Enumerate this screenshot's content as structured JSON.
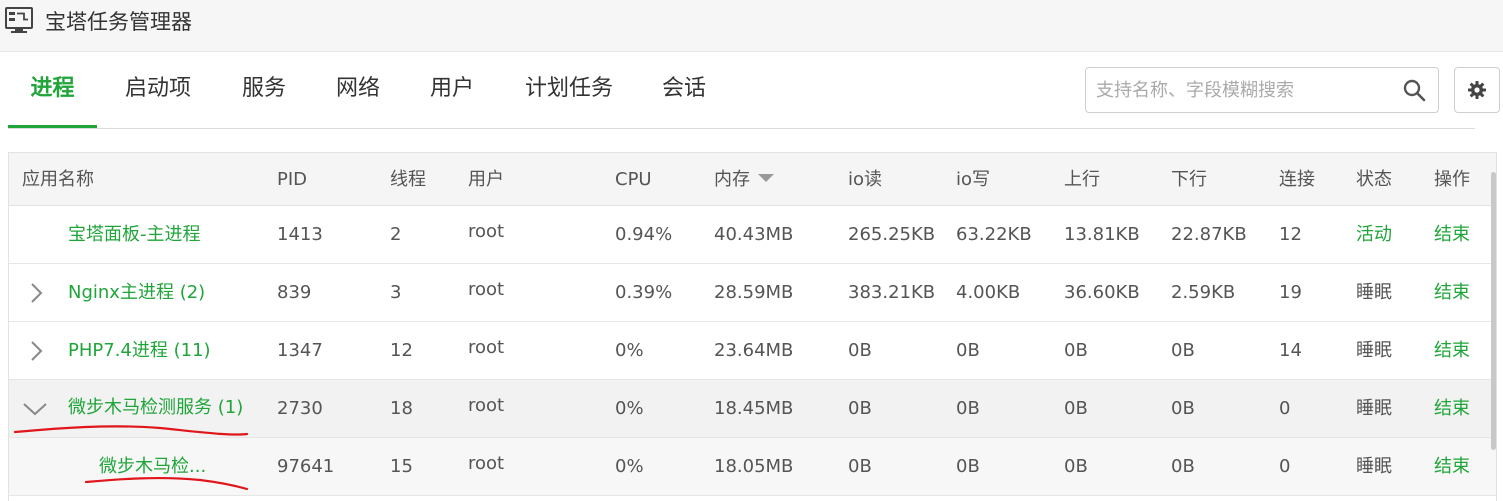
{
  "window": {
    "title": "宝塔任务管理器",
    "icon": "monitor-icon"
  },
  "tabs": [
    {
      "label": "进程",
      "active": true
    },
    {
      "label": "启动项"
    },
    {
      "label": "服务"
    },
    {
      "label": "网络"
    },
    {
      "label": "用户"
    },
    {
      "label": "计划任务"
    },
    {
      "label": "会话"
    }
  ],
  "search": {
    "placeholder": "支持名称、字段模糊搜索",
    "value": "",
    "icon": "search-icon"
  },
  "settings": {
    "icon": "gear-icon"
  },
  "columns": {
    "name": "应用名称",
    "pid": "PID",
    "threads": "线程",
    "user": "用户",
    "cpu": "CPU",
    "mem": "内存",
    "io_read": "io读",
    "io_write": "io写",
    "up": "上行",
    "down": "下行",
    "conn": "连接",
    "status": "状态",
    "action": "操作"
  },
  "sort": {
    "column": "内存",
    "direction": "desc"
  },
  "rows": [
    {
      "name": "宝塔面板-主进程",
      "count": "",
      "pid": "1413",
      "threads": "2",
      "user": "root",
      "cpu": "0.94%",
      "mem": "40.43MB",
      "io_read": "265.25KB",
      "io_write": "63.22KB",
      "up": "13.81KB",
      "down": "22.87KB",
      "conn": "12",
      "status": "活动",
      "action": "结束"
    },
    {
      "name": "Nginx主进程",
      "count": "(2)",
      "pid": "839",
      "threads": "3",
      "user": "root",
      "cpu": "0.39%",
      "mem": "28.59MB",
      "io_read": "383.21KB",
      "io_write": "4.00KB",
      "up": "36.60KB",
      "down": "2.59KB",
      "conn": "19",
      "status": "睡眠",
      "action": "结束"
    },
    {
      "name": "PHP7.4进程",
      "count": "(11)",
      "pid": "1347",
      "threads": "12",
      "user": "root",
      "cpu": "0%",
      "mem": "23.64MB",
      "io_read": "0B",
      "io_write": "0B",
      "up": "0B",
      "down": "0B",
      "conn": "14",
      "status": "睡眠",
      "action": "结束"
    },
    {
      "name": "微步木马检测服务",
      "count": "(1)",
      "pid": "2730",
      "threads": "18",
      "user": "root",
      "cpu": "0%",
      "mem": "18.45MB",
      "io_read": "0B",
      "io_write": "0B",
      "up": "0B",
      "down": "0B",
      "conn": "0",
      "status": "睡眠",
      "action": "结束"
    },
    {
      "name": "微步木马检...",
      "count": "",
      "pid": "97641",
      "threads": "15",
      "user": "root",
      "cpu": "0%",
      "mem": "18.05MB",
      "io_read": "0B",
      "io_write": "0B",
      "up": "0B",
      "down": "0B",
      "conn": "0",
      "status": "睡眠",
      "action": "结束"
    }
  ],
  "colors": {
    "accent": "#20a53a",
    "annotation": "#e0161b"
  }
}
